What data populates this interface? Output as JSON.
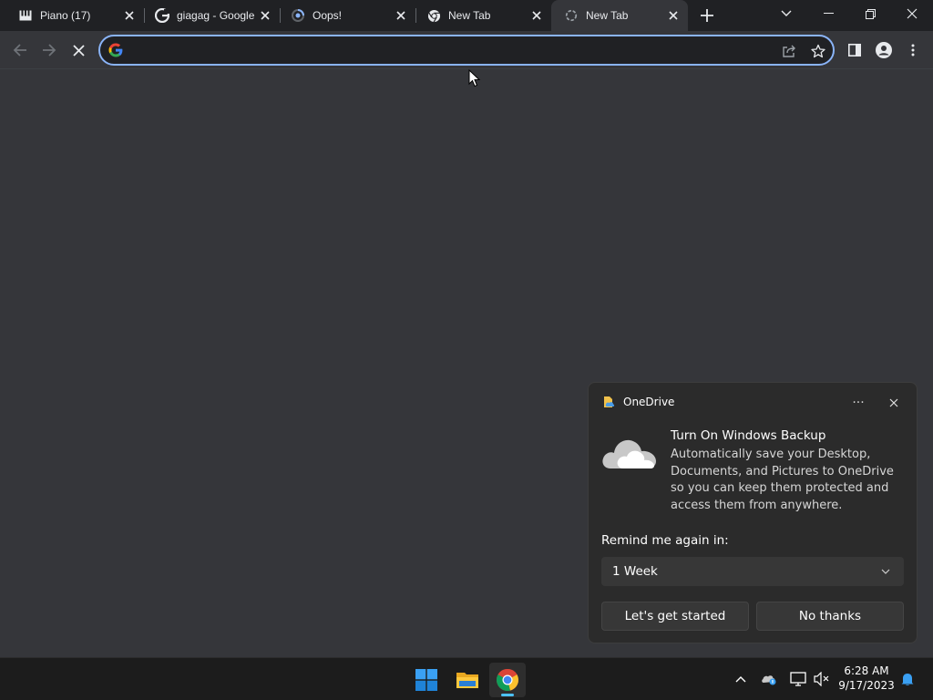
{
  "browser": {
    "tabs": [
      {
        "title": "Piano (17)",
        "favicon": "piano-icon",
        "active": false
      },
      {
        "title": "giagag - Google",
        "favicon": "google-icon",
        "active": false
      },
      {
        "title": "Oops!",
        "favicon": "loading-spinner-icon",
        "active": false
      },
      {
        "title": "New Tab",
        "favicon": "chrome-icon",
        "active": false
      },
      {
        "title": "New Tab",
        "favicon": "loading-spinner-icon",
        "active": true
      }
    ],
    "omnibox": {
      "value": "",
      "placeholder": ""
    }
  },
  "toast": {
    "app_name": "OneDrive",
    "more_label": "···",
    "heading": "Turn On Windows Backup",
    "body": "Automatically save your Desktop, Documents, and Pictures to OneDrive so you can keep them protected and access them from anywhere.",
    "remind_label": "Remind me again in:",
    "remind_selected": "1 Week",
    "primary_button": "Let's get started",
    "secondary_button": "No thanks"
  },
  "taskbar": {
    "apps": [
      "start-icon",
      "file-explorer-icon",
      "chrome-icon"
    ],
    "time": "6:28 AM",
    "date": "9/17/2023"
  },
  "colors": {
    "accent": "#8ab4f8",
    "taskbar_indicator": "#4cc2ff",
    "page_bg": "#35363a",
    "tabstrip_bg": "#202124"
  }
}
